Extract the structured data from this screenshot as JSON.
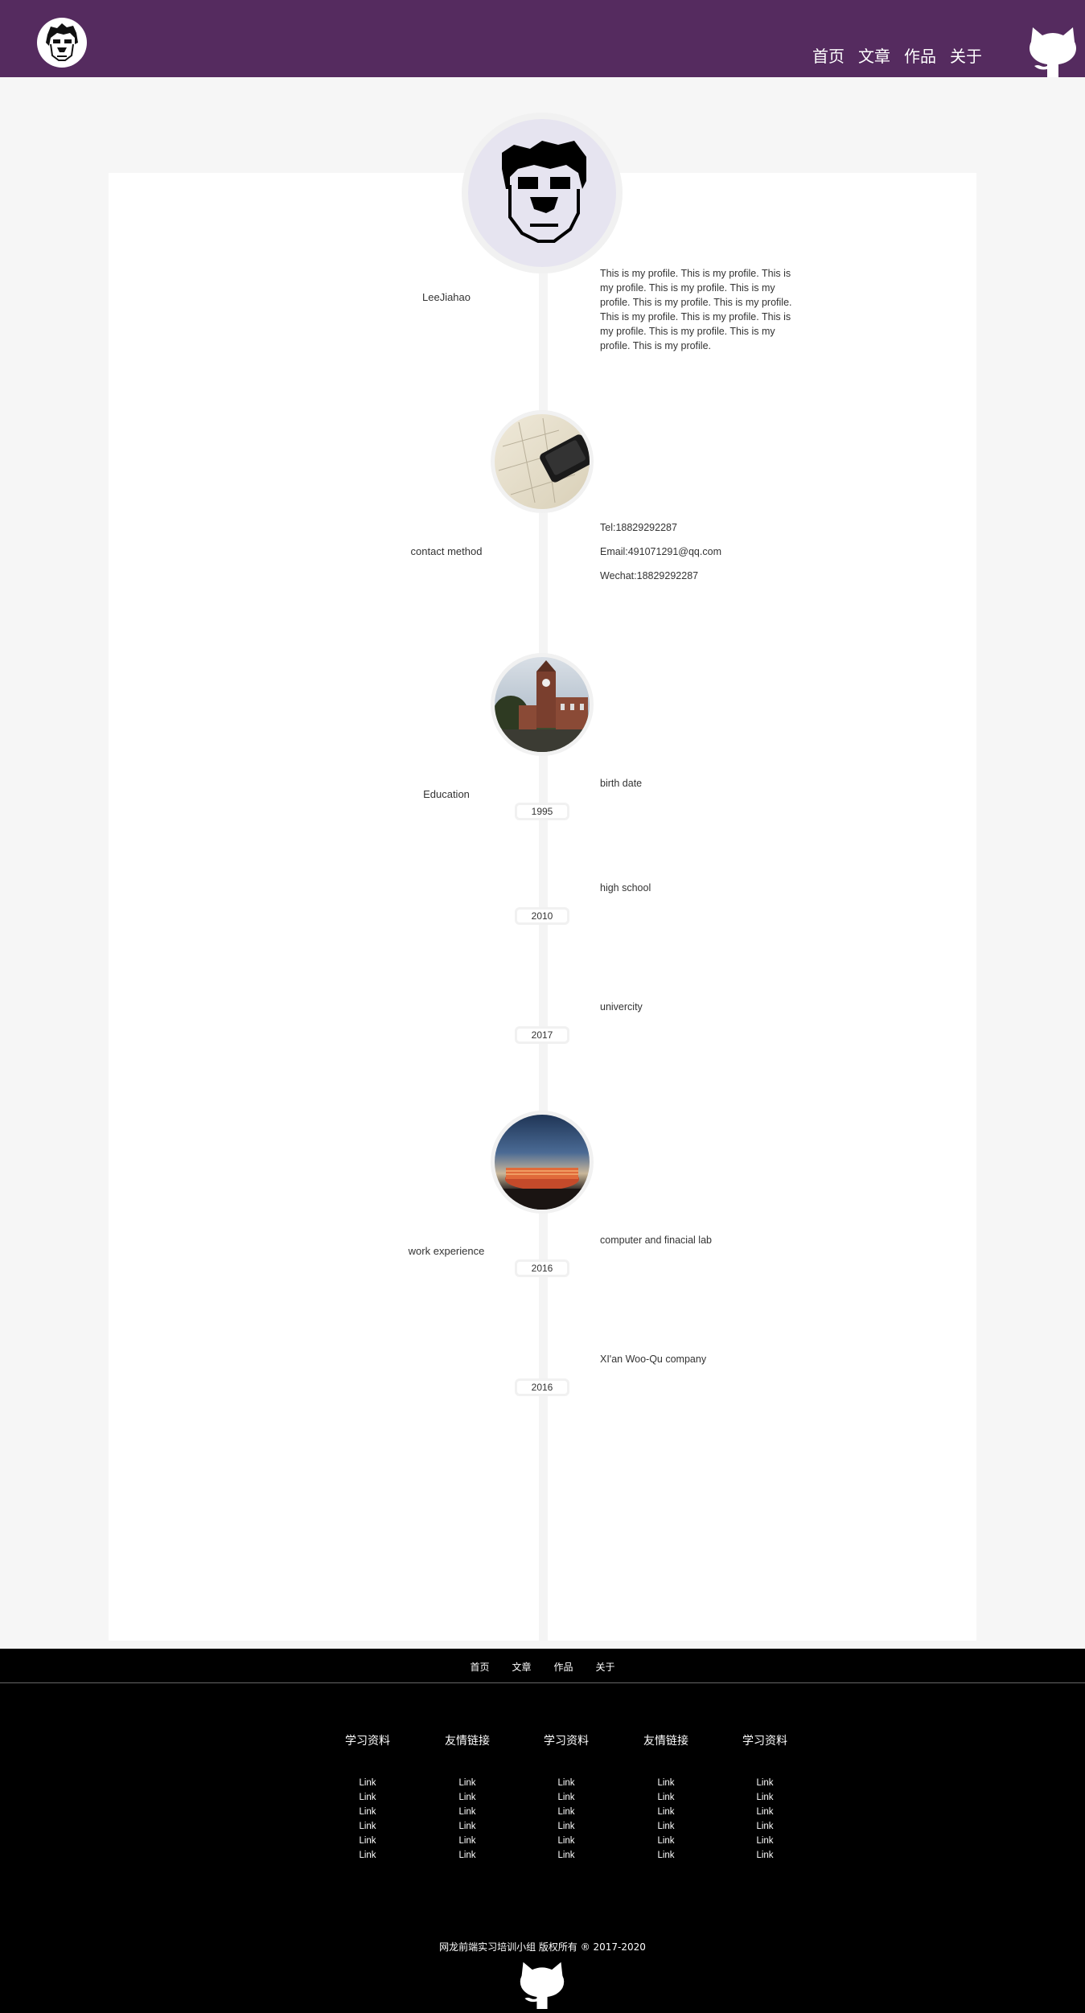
{
  "header": {
    "nav": [
      "首页",
      "文章",
      "作品",
      "关于"
    ]
  },
  "timeline": {
    "profile": {
      "name": "LeeJiahao",
      "text": "This is my profile. This is my profile. This is my profile. This is my profile. This is my profile. This is my profile. This is my profile. This is my profile. This is my profile. This is my profile. This is my profile. This is my profile. This is my profile."
    },
    "contact": {
      "label": "contact method",
      "tel": "Tel:18829292287",
      "email": "Email:491071291@qq.com",
      "wechat": "Wechat:18829292287"
    },
    "education": {
      "label": "Education",
      "items": [
        {
          "title": "birth date",
          "year": "1995"
        },
        {
          "title": "high school",
          "year": "2010"
        },
        {
          "title": "univercity",
          "year": "2017"
        }
      ]
    },
    "work": {
      "label": "work experience",
      "items": [
        {
          "title": "computer and finacial lab",
          "year": "2016"
        },
        {
          "title": "XI'an Woo-Qu company",
          "year": "2016"
        }
      ]
    }
  },
  "footer": {
    "nav": [
      "首页",
      "文章",
      "作品",
      "关于"
    ],
    "columns": [
      {
        "title": "学习资料",
        "links": [
          "Link",
          "Link",
          "Link",
          "Link",
          "Link",
          "Link"
        ]
      },
      {
        "title": "友情链接",
        "links": [
          "Link",
          "Link",
          "Link",
          "Link",
          "Link",
          "Link"
        ]
      },
      {
        "title": "学习资料",
        "links": [
          "Link",
          "Link",
          "Link",
          "Link",
          "Link",
          "Link"
        ]
      },
      {
        "title": "友情链接",
        "links": [
          "Link",
          "Link",
          "Link",
          "Link",
          "Link",
          "Link"
        ]
      },
      {
        "title": "学习资料",
        "links": [
          "Link",
          "Link",
          "Link",
          "Link",
          "Link",
          "Link"
        ]
      }
    ],
    "copyright": "网龙前端实习培训小组 版权所有 ® 2017-2020"
  },
  "colors": {
    "header_bg": "#552b5f",
    "footer_bg": "#000000",
    "page_bg": "#f6f6f6"
  },
  "icons": {
    "logo": "avatar-face-icon",
    "github": "github-octocat-icon"
  }
}
